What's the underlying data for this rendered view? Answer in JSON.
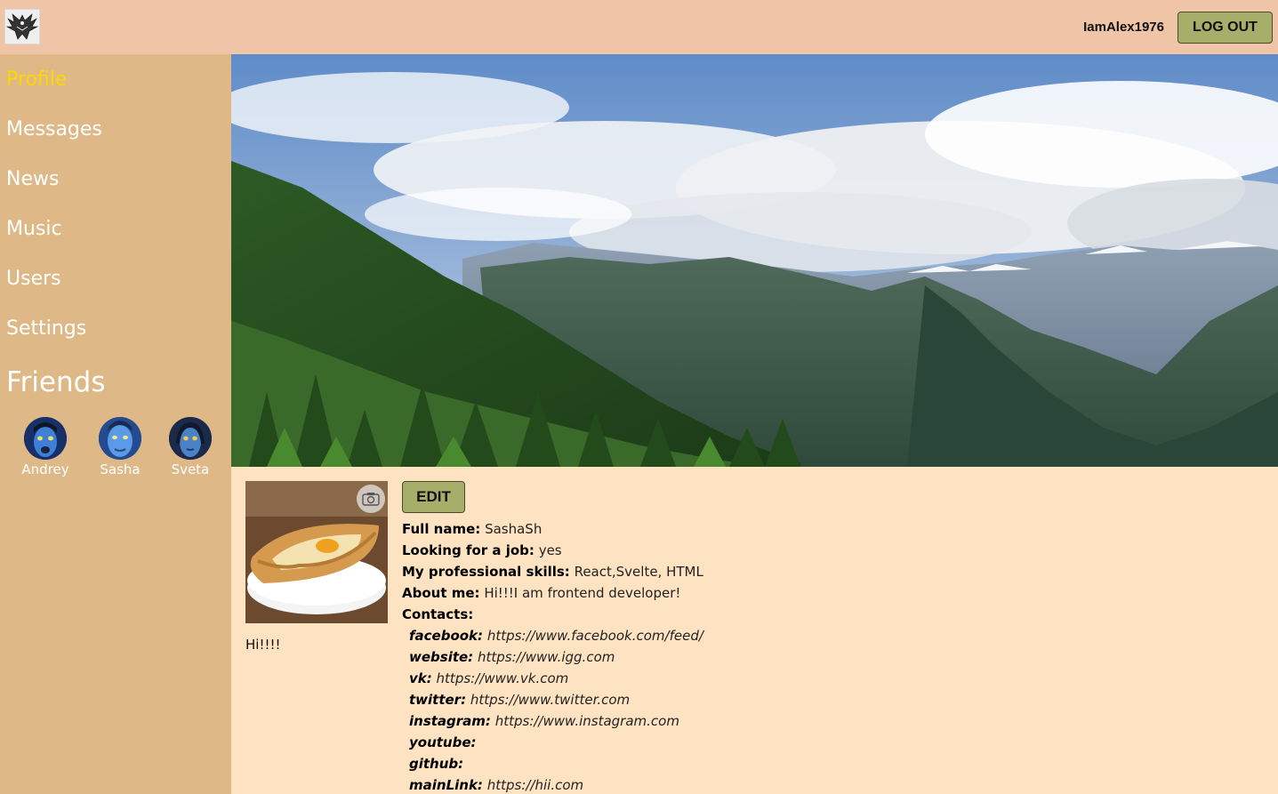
{
  "header": {
    "username": "IamAlex1976",
    "logout_label": "LOG OUT"
  },
  "sidebar": {
    "items": [
      {
        "label": "Profile",
        "active": true
      },
      {
        "label": "Messages"
      },
      {
        "label": "News"
      },
      {
        "label": "Music"
      },
      {
        "label": "Users"
      },
      {
        "label": "Settings"
      }
    ],
    "friends_title": "Friends",
    "friends": [
      {
        "name": "Andrey"
      },
      {
        "name": "Sasha"
      },
      {
        "name": "Sveta"
      }
    ]
  },
  "profile": {
    "status": "Hi!!!!",
    "edit_label": "EDIT",
    "fields": [
      {
        "label": "Full name:",
        "value": "SashaSh"
      },
      {
        "label": "Looking for a job:",
        "value": "yes"
      },
      {
        "label": "My professional skills:",
        "value": "React,Svelte, HTML"
      },
      {
        "label": "About me:",
        "value": "Hi!!!I am frontend developer!"
      }
    ],
    "contacts_label": "Contacts:",
    "contacts": [
      {
        "label": "facebook:",
        "value": "https://www.facebook.com/feed/"
      },
      {
        "label": "website:",
        "value": "https://www.igg.com"
      },
      {
        "label": "vk:",
        "value": "https://www.vk.com"
      },
      {
        "label": "twitter:",
        "value": "https://www.twitter.com"
      },
      {
        "label": "instagram:",
        "value": "https://www.instagram.com"
      },
      {
        "label": "youtube:",
        "value": ""
      },
      {
        "label": "github:",
        "value": ""
      },
      {
        "label": "mainLink:",
        "value": "https://hii.com"
      }
    ]
  },
  "colors": {
    "header_bg": "#f0c4a6",
    "sidebar_bg": "#deb887",
    "content_bg": "#fde3c1",
    "active_link": "#ffd700",
    "button_bg": "#a7ae6a"
  },
  "icons": [
    "phoenix-logo-icon",
    "camera-icon"
  ]
}
